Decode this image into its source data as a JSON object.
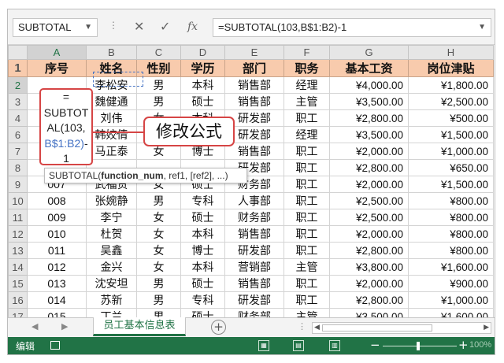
{
  "formula_bar": {
    "name_box": "SUBTOTAL",
    "cancel_glyph": "✕",
    "enter_glyph": "✓",
    "fx_glyph": "fx",
    "formula": "=SUBTOTAL(103,B$1:B2)-1"
  },
  "columns": [
    "A",
    "B",
    "C",
    "D",
    "E",
    "F",
    "G",
    "H"
  ],
  "rows": [
    {
      "n": "1",
      "cells": [
        "序号",
        "姓名",
        "性别",
        "学历",
        "部门",
        "职务",
        "基本工资",
        "岗位津贴"
      ]
    },
    {
      "n": "2",
      "cells": [
        "",
        "李松安",
        "男",
        "本科",
        "销售部",
        "经理",
        "¥4,000.00",
        "¥1,800.00"
      ]
    },
    {
      "n": "3",
      "cells": [
        "",
        "魏健通",
        "男",
        "硕士",
        "销售部",
        "主管",
        "¥3,500.00",
        "¥2,500.00"
      ]
    },
    {
      "n": "4",
      "cells": [
        "",
        "刘伟",
        "女",
        "本科",
        "研发部",
        "职工",
        "¥2,800.00",
        "¥500.00"
      ]
    },
    {
      "n": "6",
      "cells": [
        "",
        "韩姣倩",
        "女",
        "硕士",
        "研发部",
        "经理",
        "¥3,500.00",
        "¥1,500.00"
      ]
    },
    {
      "n": "7",
      "cells": [
        "",
        "马正泰",
        "女",
        "博士",
        "销售部",
        "职工",
        "¥2,000.00",
        "¥1,000.00"
      ]
    },
    {
      "n": "8",
      "cells": [
        "",
        "",
        "",
        "",
        "研发部",
        "职工",
        "¥2,800.00",
        "¥650.00"
      ]
    },
    {
      "n": "9",
      "cells": [
        "007",
        "武福贵",
        "女",
        "硕士",
        "财务部",
        "职工",
        "¥2,000.00",
        "¥1,500.00"
      ]
    },
    {
      "n": "10",
      "cells": [
        "008",
        "张婉静",
        "男",
        "专科",
        "人事部",
        "职工",
        "¥2,500.00",
        "¥800.00"
      ]
    },
    {
      "n": "11",
      "cells": [
        "009",
        "李宁",
        "女",
        "硕士",
        "财务部",
        "职工",
        "¥2,500.00",
        "¥800.00"
      ]
    },
    {
      "n": "12",
      "cells": [
        "010",
        "杜贺",
        "女",
        "本科",
        "销售部",
        "职工",
        "¥2,000.00",
        "¥800.00"
      ]
    },
    {
      "n": "13",
      "cells": [
        "011",
        "吴鑫",
        "女",
        "博士",
        "研发部",
        "职工",
        "¥2,800.00",
        "¥800.00"
      ]
    },
    {
      "n": "14",
      "cells": [
        "012",
        "金兴",
        "女",
        "本科",
        "营销部",
        "主管",
        "¥3,800.00",
        "¥1,600.00"
      ]
    },
    {
      "n": "15",
      "cells": [
        "013",
        "沈安坦",
        "男",
        "硕士",
        "销售部",
        "职工",
        "¥2,000.00",
        "¥900.00"
      ]
    },
    {
      "n": "16",
      "cells": [
        "014",
        "苏新",
        "男",
        "专科",
        "研发部",
        "职工",
        "¥2,800.00",
        "¥1,000.00"
      ]
    },
    {
      "n": "17",
      "cells": [
        "015",
        "丁兰",
        "男",
        "硕士",
        "财务部",
        "主管",
        "¥3,500.00",
        "¥1,600.00"
      ]
    }
  ],
  "edit_cell": {
    "line1": "=",
    "line2": "SUBTOT",
    "line3": "AL(103,",
    "line4_ref": "B$1:B2)",
    "line4_tail": "-",
    "line5": "1"
  },
  "callout": "修改公式",
  "tooltip": {
    "fn": "SUBTOTAL(",
    "arg_bold": "function_num",
    "rest": ", ref1, [ref2], ...)"
  },
  "sheet_tab": "员工基本信息表",
  "status": {
    "mode": "编辑",
    "zoom": "100%"
  },
  "colors": {
    "excel_green": "#217346",
    "header_fill": "#f8cbad",
    "callout_border": "#d64545",
    "ref_blue": "#4472c4"
  }
}
